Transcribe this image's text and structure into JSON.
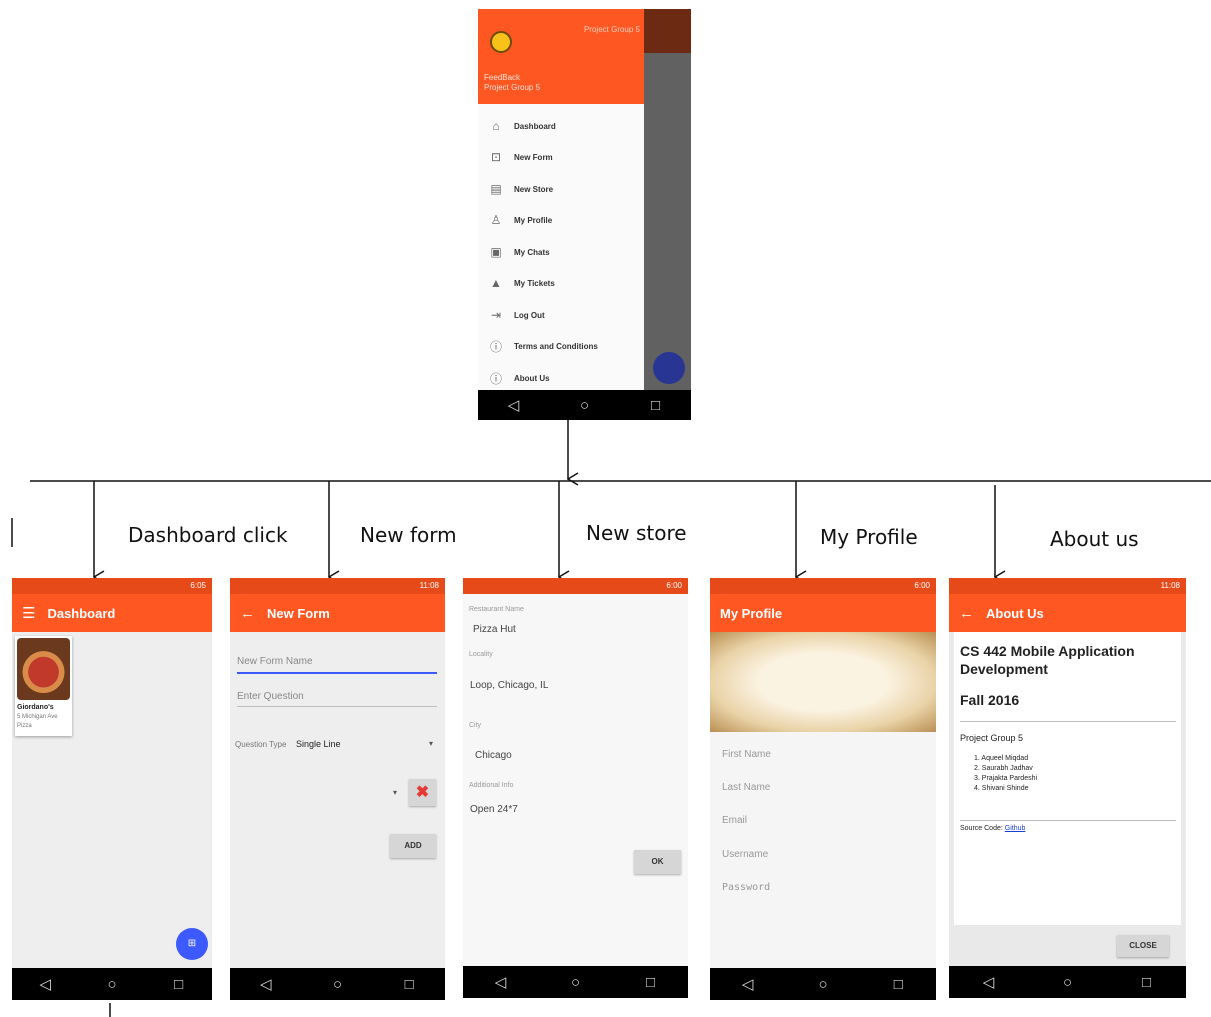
{
  "captions": [
    "Dashboard click",
    "New form",
    "New store",
    "My Profile",
    "About us"
  ],
  "icons": [
    "menu-icon",
    "back-icon",
    "close-icon",
    "chat-icon"
  ],
  "colors": {
    "primary": "#ff5722",
    "status": "#e64a19",
    "fab": "#3d5afe",
    "close_red": "#e53935"
  },
  "drawer": {
    "corner_text": "Project Group 5",
    "app_name": "FeedBack",
    "subtitle": "Project Group 5",
    "items": [
      "Dashboard",
      "New Form",
      "New Store",
      "My Profile",
      "My Chats",
      "My Tickets",
      "Log Out",
      "Terms and Conditions",
      "About Us"
    ]
  },
  "dashboard": {
    "title": "Dashboard",
    "card_name": "Giordano's",
    "card_address": "5 Michigan Ave",
    "card_type": "Pizza",
    "time": "6:05"
  },
  "new_form": {
    "title": "New Form",
    "name_placeholder": "New Form Name",
    "question_placeholder": "Enter Question",
    "question_type_label": "Question Type",
    "question_type_value": "Single Line",
    "add_label": "ADD",
    "time": "11:08"
  },
  "new_store": {
    "name_label": "Restaurant Name",
    "name_value": "Pizza Hut",
    "locality_label": "Locality",
    "locality_value": "Loop, Chicago, IL",
    "city_label": "City",
    "city_value": "Chicago",
    "info_label": "Additional Info",
    "info_value": "Open 24*7",
    "ok_label": "OK",
    "time": "6:00"
  },
  "my_profile": {
    "title": "My Profile",
    "fields": [
      "First Name",
      "Last Name",
      "Email",
      "Username",
      "Password"
    ],
    "time": "6:00"
  },
  "about_us": {
    "title": "About Us",
    "heading": "CS 442 Mobile Application Development",
    "term": "Fall 2016",
    "group": "Project Group 5",
    "members": [
      "1.  Aqueel Miqdad",
      "2.  Saurabh Jadhav",
      "3.  Prajakta Pardeshi",
      "4.  Shivani Shinde"
    ],
    "source_label": "Source Code:",
    "source_link": "Github",
    "close_label": "CLOSE",
    "time": "11:08"
  }
}
